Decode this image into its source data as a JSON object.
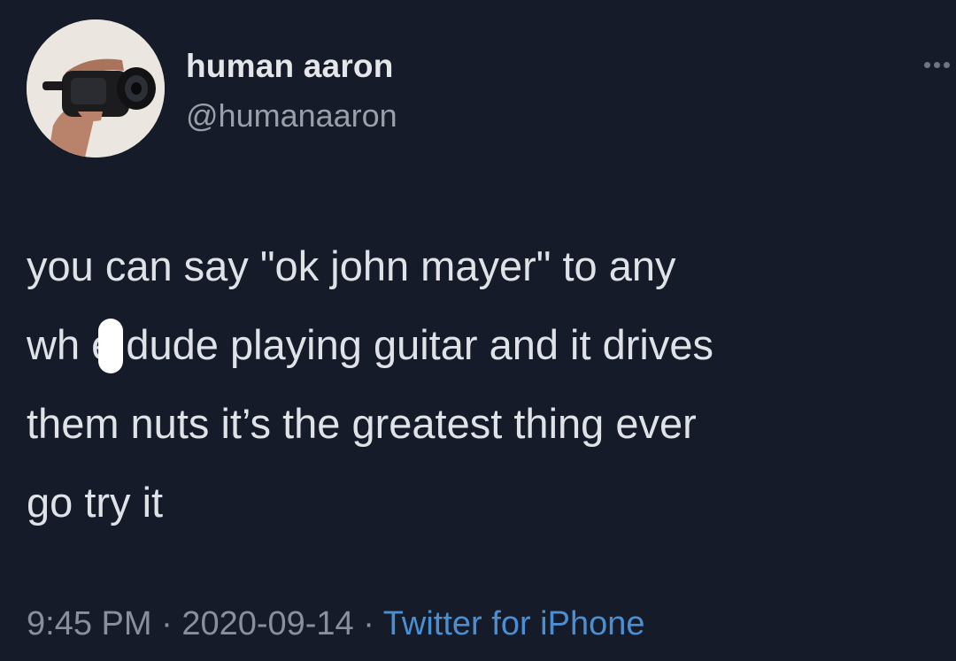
{
  "tweet": {
    "display_name": "human aaron",
    "handle": "@humanaaron",
    "text": "you can say \"ok john mayer\" to any\nwh  e dude playing guitar and it drives\nthem nuts it’s the greatest thing ever\ngo try it",
    "time": "9:45 PM",
    "separator": " · ",
    "date": "2020-09-14",
    "source": "Twitter for iPhone",
    "more_icon": "more-horizontal-icon",
    "avatar_icon": "camcorder-in-hand-icon"
  },
  "colors": {
    "background": "#151b29",
    "text": "#dfe2e7",
    "secondary_text": "#8a909b",
    "link": "#4b8fd3",
    "redaction": "#ffffff"
  }
}
